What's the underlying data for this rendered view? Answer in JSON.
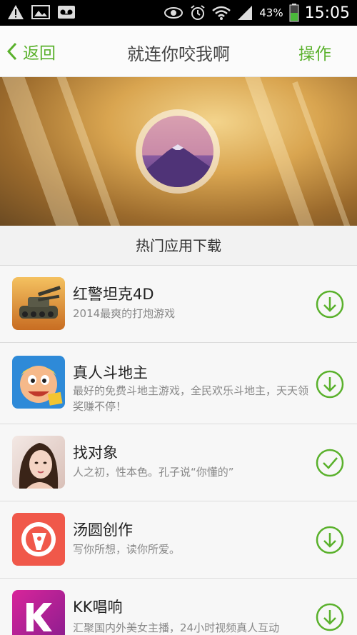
{
  "status_bar": {
    "battery_percent": "43%",
    "time": "15:05"
  },
  "header": {
    "back_label": "返回",
    "title": "就连你咬我啊",
    "action_label": "操作"
  },
  "section": {
    "title": "热门应用下载"
  },
  "apps": [
    {
      "name": "红警坦克4D",
      "desc": "2014最爽的打炮游戏",
      "icon": "tank-icon",
      "state": "download"
    },
    {
      "name": "真人斗地主",
      "desc": "最好的免费斗地主游戏，全民欢乐斗地主，天天领奖赚不停！",
      "icon": "cartoon-face-icon",
      "state": "download"
    },
    {
      "name": "找对象",
      "desc": "人之初，性本色。孔子说“你懂的”",
      "icon": "woman-photo-icon",
      "state": "installed"
    },
    {
      "name": "汤圆创作",
      "desc": "写你所想，读你所爱。",
      "icon": "pen-nib-icon",
      "state": "download"
    },
    {
      "name": "KK唱响",
      "desc": "汇聚国内外美女主播，24小时视频真人互动",
      "icon": "kk-logo-icon",
      "state": "download"
    }
  ],
  "colors": {
    "accent": "#5ab12c",
    "header_bg": "#fbfbfb",
    "list_bg": "#f7f7f7",
    "statusbar_bg": "#000000"
  }
}
